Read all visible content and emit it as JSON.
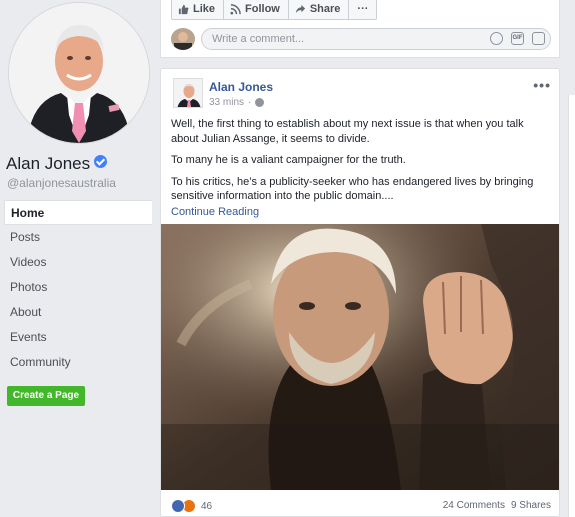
{
  "page": {
    "name": "Alan Jones",
    "handle": "@alanjonesaustralia"
  },
  "nav": {
    "items": [
      "Home",
      "Posts",
      "Videos",
      "Photos",
      "About",
      "Events",
      "Community"
    ],
    "create_page_label": "Create a Page"
  },
  "actions": {
    "like_label": "Like",
    "follow_label": "Follow",
    "share_label": "Share",
    "more_label": "···"
  },
  "comment": {
    "placeholder": "Write a comment..."
  },
  "post": {
    "author": "Alan Jones",
    "time": "33 mins",
    "menu": "•••",
    "paragraphs": [
      "Well, the first thing to establish about my next issue is that when you talk about Julian Assange, it seems to divide.",
      "To many he is a valiant campaigner for the truth.",
      "To his critics, he’s a publicity-seeker who has endangered lives by bringing sensitive information into the public domain...."
    ],
    "continue_label": "Continue Reading",
    "reaction_count": "46",
    "comments_label": "24 Comments",
    "shares_label": "9 Shares"
  },
  "colors": {
    "link": "#365899",
    "create_page_bg": "#42b72a",
    "verified": "#4080ff",
    "background": "#e9ebee"
  },
  "icons": [
    "verified-badge-icon",
    "like-icon",
    "rss-follow-icon",
    "share-arrow-icon",
    "more-icon",
    "emoji-icon",
    "gif-icon",
    "sticker-icon",
    "globe-icon",
    "like-reaction-icon",
    "angry-reaction-icon"
  ]
}
